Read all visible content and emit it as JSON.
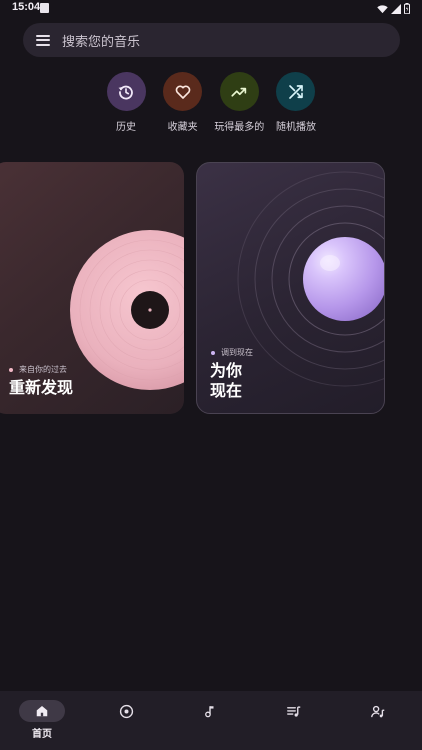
{
  "status_bar": {
    "time": "15:04"
  },
  "search": {
    "placeholder": "搜索您的音乐"
  },
  "quick_actions": [
    {
      "label": "历史",
      "icon": "history-icon",
      "color": "#4a3660"
    },
    {
      "label": "收藏夹",
      "icon": "heart-icon",
      "color": "#5a2a1c"
    },
    {
      "label": "玩得最多的",
      "icon": "trending-up-icon",
      "color": "#2f3e14"
    },
    {
      "label": "随机播放",
      "icon": "shuffle-icon",
      "color": "#0f3f4a"
    }
  ],
  "cards": [
    {
      "subtitle": "来自你的过去",
      "title": "重新发现",
      "accent": "#f2b8c6"
    },
    {
      "subtitle": "调到现在",
      "title_line1": "为你",
      "title_line2": "现在",
      "accent": "#cdb5f2"
    }
  ],
  "bottom_nav": {
    "items": [
      {
        "label": "首页",
        "icon": "home-icon",
        "active": true
      },
      {
        "icon": "album-icon"
      },
      {
        "icon": "music-note-icon"
      },
      {
        "icon": "playlist-icon"
      },
      {
        "icon": "artist-icon"
      }
    ]
  }
}
